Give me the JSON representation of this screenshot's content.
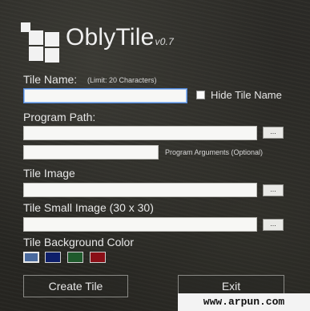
{
  "app": {
    "name": "OblyTile",
    "version": "v0.7"
  },
  "tile_name": {
    "label": "Tile Name:",
    "limit_note": "(Limit: 20 Characters)",
    "value": "",
    "hide_label": "Hide Tile Name",
    "hide_checked": false
  },
  "program_path": {
    "label": "Program Path:",
    "value": "",
    "browse": "...",
    "args_value": "",
    "args_label": "Program Arguments (Optional)"
  },
  "tile_image": {
    "label": "Tile Image",
    "value": "",
    "browse": "..."
  },
  "tile_small_image": {
    "label": "Tile Small Image (30 x 30)",
    "value": "",
    "browse": "..."
  },
  "background": {
    "label": "Tile Background Color",
    "colors": [
      "#4a6a9e",
      "#0e1f6a",
      "#1f5a2c",
      "#8a0f17"
    ],
    "selected_index": 0
  },
  "buttons": {
    "create": "Create Tile",
    "exit": "Exit"
  },
  "watermark": "www.arpun.com"
}
